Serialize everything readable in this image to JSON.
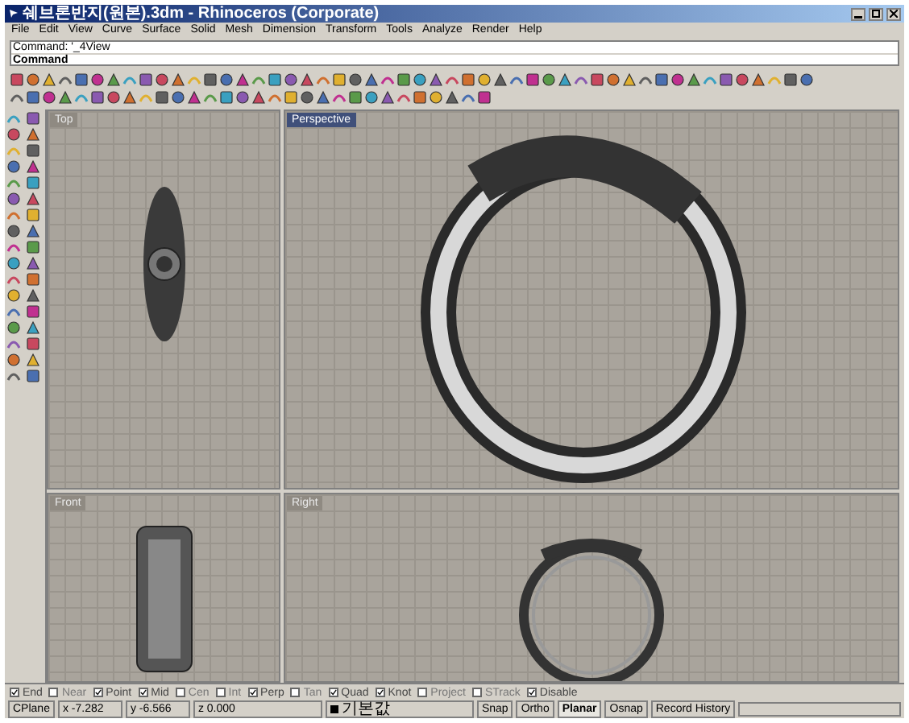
{
  "window": {
    "title": "쉐브론반지(원본).3dm - Rhinoceros (Corporate)"
  },
  "menu": [
    "File",
    "Edit",
    "View",
    "Curve",
    "Surface",
    "Solid",
    "Mesh",
    "Dimension",
    "Transform",
    "Tools",
    "Analyze",
    "Render",
    "Help"
  ],
  "command": {
    "history": "Command: '_4View",
    "prompt": "Command"
  },
  "viewports": [
    {
      "label": "Top",
      "selected": false
    },
    {
      "label": "Perspective",
      "selected": true
    },
    {
      "label": "Front",
      "selected": false
    },
    {
      "label": "Right",
      "selected": false
    }
  ],
  "osnaps": [
    {
      "label": "End",
      "checked": true
    },
    {
      "label": "Near",
      "checked": false
    },
    {
      "label": "Point",
      "checked": true
    },
    {
      "label": "Mid",
      "checked": true
    },
    {
      "label": "Cen",
      "checked": false
    },
    {
      "label": "Int",
      "checked": false
    },
    {
      "label": "Perp",
      "checked": true
    },
    {
      "label": "Tan",
      "checked": false
    },
    {
      "label": "Quad",
      "checked": true
    },
    {
      "label": "Knot",
      "checked": true
    },
    {
      "label": "Project",
      "checked": false
    },
    {
      "label": "STrack",
      "checked": false
    },
    {
      "label": "Disable",
      "checked": true
    }
  ],
  "status_bar": {
    "cplane": "CPlane",
    "x": "x -7.282",
    "y": "y -6.566",
    "z": "z 0.000",
    "layer": "기본값",
    "panes": [
      {
        "label": "Snap",
        "on": false
      },
      {
        "label": "Ortho",
        "on": false
      },
      {
        "label": "Planar",
        "on": true
      },
      {
        "label": "Osnap",
        "on": false
      },
      {
        "label": "Record History",
        "on": false
      }
    ]
  }
}
